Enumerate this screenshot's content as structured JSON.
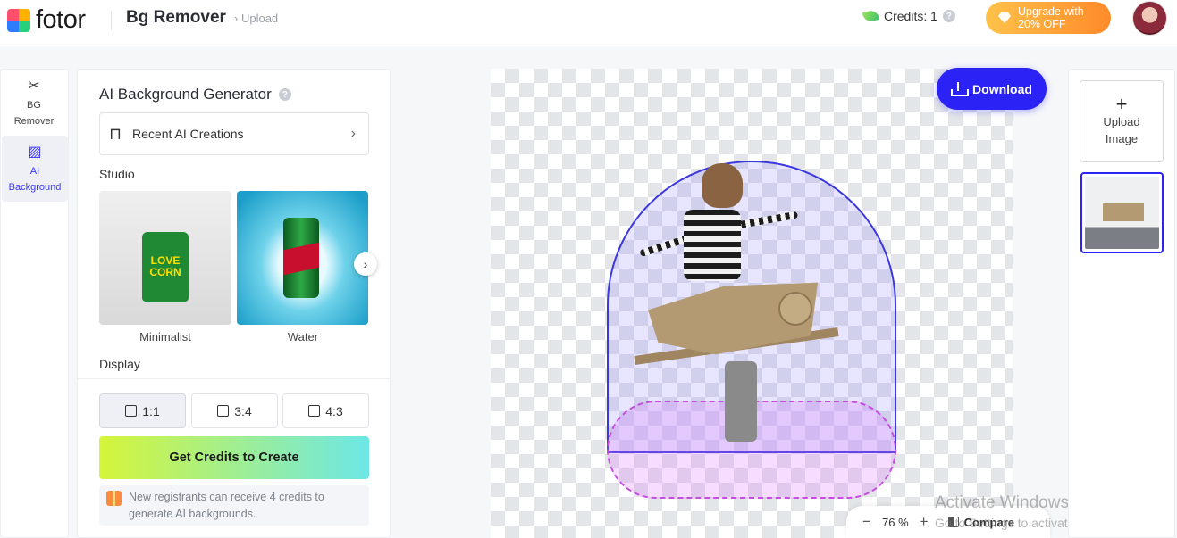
{
  "header": {
    "logo_text": "fotor",
    "app_title": "Bg Remover",
    "breadcrumb": "Upload",
    "credits_label": "Credits: 1",
    "help_symbol": "?",
    "upgrade_line1": "Upgrade with",
    "upgrade_line2": "20% OFF"
  },
  "rail": {
    "items": [
      {
        "label_line1": "BG",
        "label_line2": "Remover",
        "icon": "scissors-icon"
      },
      {
        "label_line1": "AI",
        "label_line2": "Background",
        "icon": "ai-background-icon"
      }
    ]
  },
  "panel": {
    "title": "AI Background Generator",
    "recent_label": "Recent AI Creations",
    "studio_label": "Studio",
    "thumbnails": [
      {
        "label": "Minimalist"
      },
      {
        "label": "Water"
      }
    ],
    "display_label": "Display",
    "ratios": [
      "1:1",
      "3:4",
      "4:3"
    ],
    "selected_ratio": "1:1",
    "create_button": "Get Credits to Create",
    "notice_line1": "New registrants can receive 4 credits to",
    "notice_line2": "generate AI backgrounds."
  },
  "canvas": {
    "download_label": "Download",
    "zoom_value": "76 %",
    "compare_label": "Compare"
  },
  "watermark": {
    "line1": "Activate Windows",
    "line2": "Go to Settings to activate Windows."
  },
  "right": {
    "upload_line1": "Upload",
    "upload_line2": "Image"
  },
  "colors": {
    "accent": "#2b22f5",
    "upgrade_gradient": [
      "#ffc24a",
      "#ff8a2a"
    ],
    "create_gradient": [
      "#d6f53a",
      "#6ce7e6"
    ]
  }
}
